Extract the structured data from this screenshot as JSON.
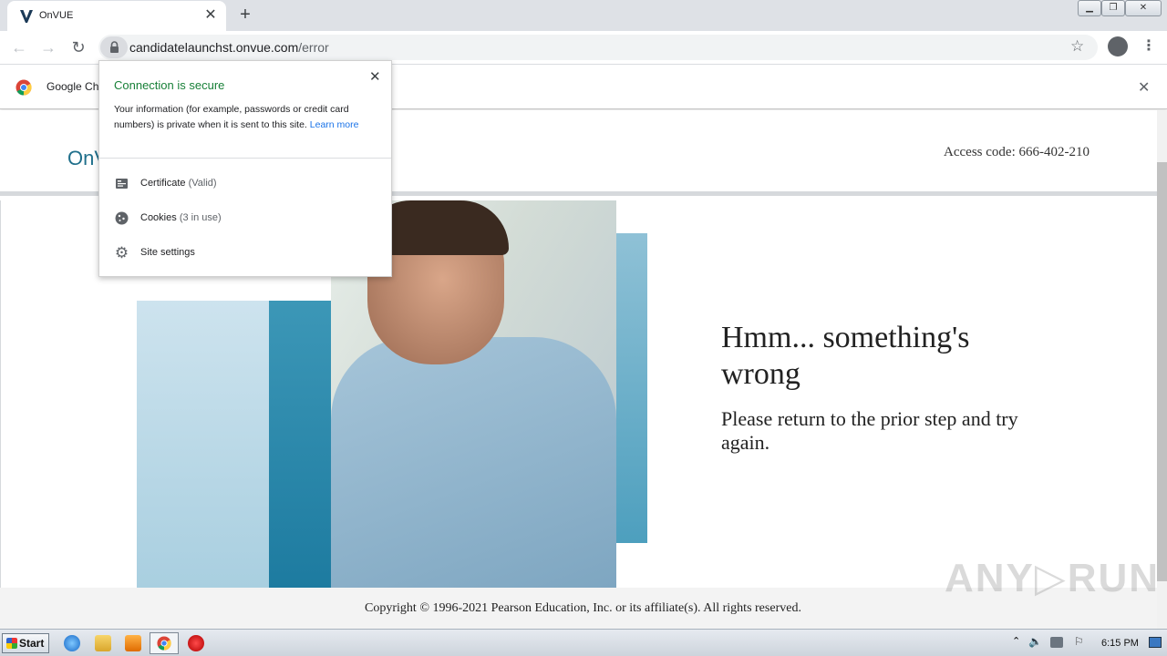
{
  "browser": {
    "tab_title": "OnVUE",
    "tab_close": "✕",
    "new_tab": "+",
    "url_host": "candidatelaunchst.onvue.com",
    "url_path": "/error",
    "star": "☆",
    "menu": "⋮",
    "window_buttons": {
      "minimize": "▁",
      "maximize": "❐",
      "close": "✕"
    }
  },
  "infobar": {
    "text": "Google Ch",
    "close": "✕"
  },
  "popup": {
    "title": "Connection is secure",
    "close": "✕",
    "description": "Your information (for example, passwords or credit card numbers) is private when it is sent to this site.",
    "learn_more": "Learn more",
    "items": [
      {
        "label": "Certificate",
        "sub": "(Valid)",
        "icon": "certificate-icon"
      },
      {
        "label": "Cookies",
        "sub": "(3 in use)",
        "icon": "cookie-icon"
      },
      {
        "label": "Site settings",
        "sub": "",
        "icon": "gear-icon"
      }
    ]
  },
  "page": {
    "logo": "OnV",
    "access_code": "Access code: 666-402-210",
    "error_title": "Hmm... something's wrong",
    "error_subtitle": "Please return to the prior step and try again.",
    "copyright": "Copyright © 1996-2021 Pearson Education, Inc. or its affiliate(s). All rights reserved.",
    "watermark": "ANY▷RUN"
  },
  "taskbar": {
    "start": "Start",
    "clock": "6:15 PM"
  },
  "colors": {
    "secure_green": "#188038",
    "link_blue": "#1a73e8",
    "brand_teal": "#1f6f8b"
  }
}
